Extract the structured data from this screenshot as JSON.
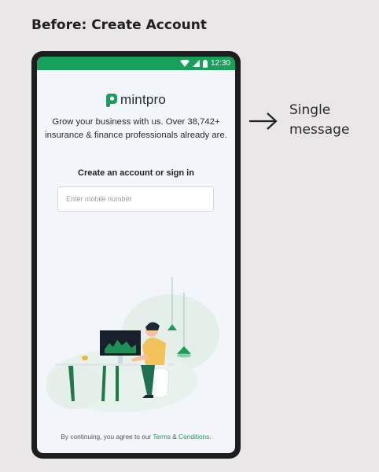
{
  "heading": "Before: Create Account",
  "status_bar": {
    "time": "12:30",
    "icons": [
      "wifi-icon",
      "cellular-signal-icon",
      "battery-icon"
    ]
  },
  "app": {
    "brand_name": "mintpro",
    "tagline_line1": "Grow your business with us. Over 38,742+",
    "tagline_line2": "insurance & finance professionals already are.",
    "prompt": "Create an account or sign in",
    "mobile_input": {
      "placeholder": "Enter mobile number",
      "value": ""
    },
    "footer": {
      "prefix": "By continuing, you agree to our ",
      "terms_link": "Terms",
      "separator": " & ",
      "conditions_link": "Conditions",
      "suffix": "."
    },
    "colors": {
      "brand_green": "#16a05a",
      "background": "#f2f6fb"
    }
  },
  "side_note": {
    "arrow_icon": "right-arrow-icon",
    "line1": "Single",
    "line2": "message"
  }
}
